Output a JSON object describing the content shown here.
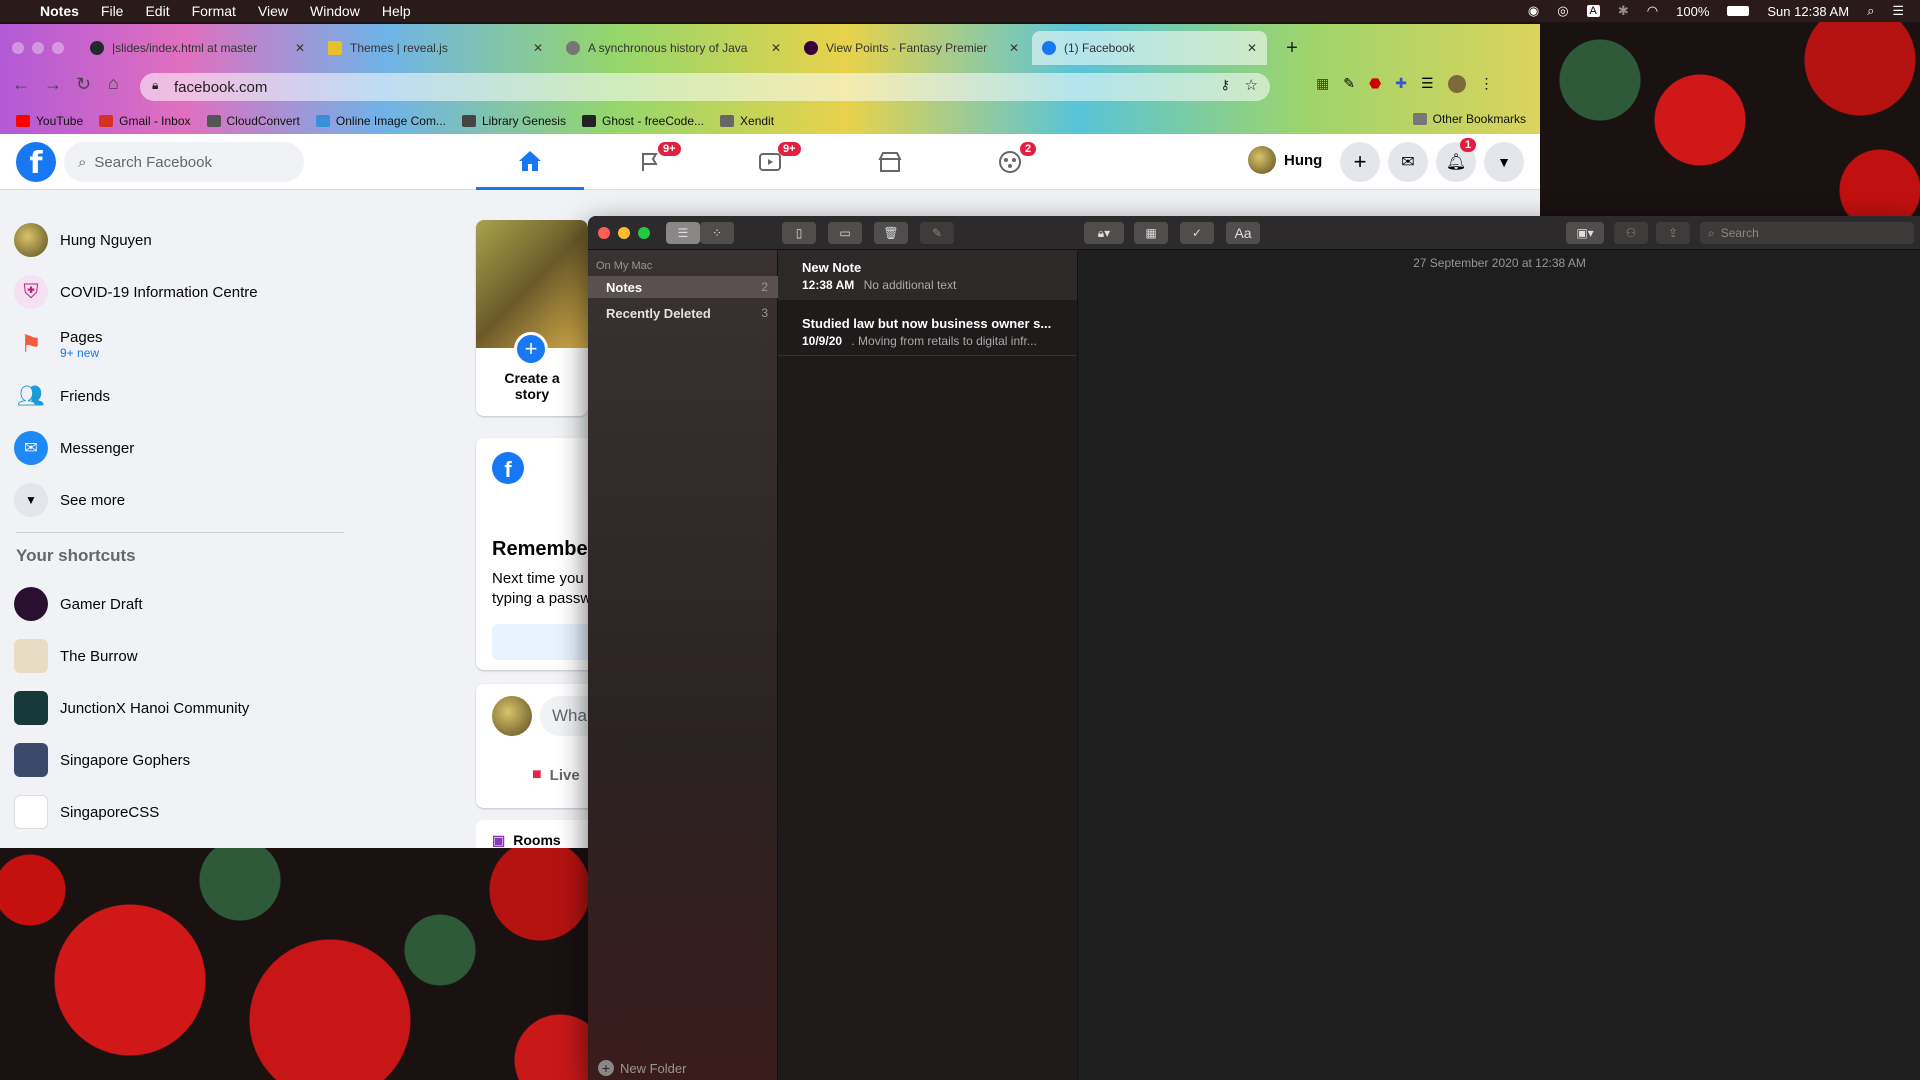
{
  "menubar": {
    "app": "Notes",
    "items": [
      "File",
      "Edit",
      "Format",
      "View",
      "Window",
      "Help"
    ],
    "battery": "100%",
    "clock": "Sun 12:38 AM"
  },
  "chrome": {
    "tabs": [
      {
        "title": "|slides/index.html at master",
        "icon_color": "#24292e"
      },
      {
        "title": "Themes | reveal.js",
        "icon_color": "#e6c229"
      },
      {
        "title": "A synchronous history of Java",
        "icon_color": "#777777"
      },
      {
        "title": "View Points - Fantasy Premier",
        "icon_color": "#37003c"
      },
      {
        "title": "(1) Facebook",
        "icon_color": "#1877f2"
      }
    ],
    "url": "facebook.com",
    "bookmarks": [
      {
        "label": "YouTube",
        "color": "#ff0000"
      },
      {
        "label": "Gmail - Inbox",
        "color": "#d93025"
      },
      {
        "label": "CloudConvert",
        "color": "#555555"
      },
      {
        "label": "Online Image Com...",
        "color": "#3a8fd9"
      },
      {
        "label": "Library Genesis",
        "color": "#444444"
      },
      {
        "label": "Ghost - freeCode...",
        "color": "#222222"
      },
      {
        "label": "Xendit",
        "color": "#666666"
      }
    ],
    "other_bookmarks": "Other Bookmarks"
  },
  "facebook": {
    "search_placeholder": "Search Facebook",
    "badges": {
      "groups": "9+",
      "watch": "9+",
      "gaming": "2",
      "notifications": "1"
    },
    "user_first": "Hung",
    "left_nav": [
      {
        "label": "Hung Nguyen",
        "sub": ""
      },
      {
        "label": "COVID-19 Information Centre",
        "sub": ""
      },
      {
        "label": "Pages",
        "sub": "9+ new"
      },
      {
        "label": "Friends",
        "sub": ""
      },
      {
        "label": "Messenger",
        "sub": ""
      },
      {
        "label": "See more",
        "sub": ""
      }
    ],
    "shortcuts_heading": "Your shortcuts",
    "shortcuts": [
      "Gamer Draft",
      "The Burrow",
      "JunctionX Hanoi Community",
      "Singapore Gophers",
      "SingaporeCSS"
    ],
    "story_label": "Create a story",
    "remember_title": "Remembe",
    "remember_text_1": "Next time you",
    "remember_text_2": "typing a passw",
    "post_placeholder": "Wha",
    "live_label": "Live",
    "rooms_label": "Rooms"
  },
  "notes": {
    "search_placeholder": "Search",
    "section": "On My Mac",
    "folders": [
      {
        "name": "Notes",
        "count": "2"
      },
      {
        "name": "Recently Deleted",
        "count": "3"
      }
    ],
    "new_folder": "New Folder",
    "list": [
      {
        "title": "New Note",
        "time": "12:38 AM",
        "preview": "No additional text"
      },
      {
        "title": "Studied law but now business owner s...",
        "time": "10/9/20",
        "preview": ". Moving from retails to digital infr..."
      }
    ],
    "editor_date": "27 September 2020 at 12:38 AM",
    "format_btn": "Aa"
  },
  "colors": {
    "facebook_blue": "#1877f2",
    "badge_red": "#e41e3f"
  }
}
